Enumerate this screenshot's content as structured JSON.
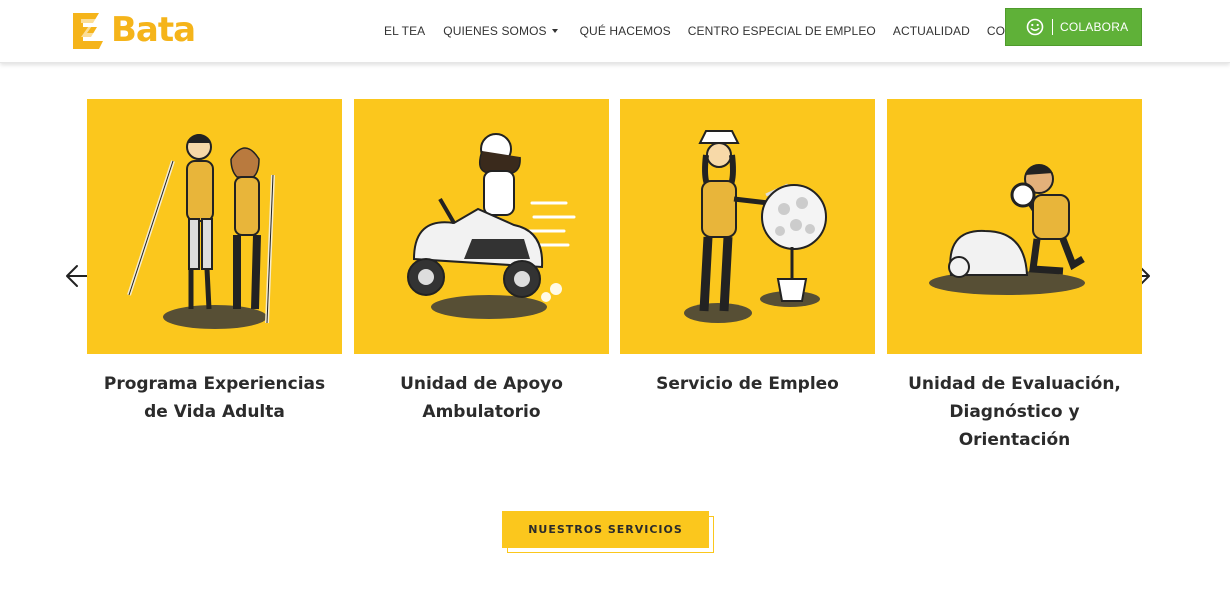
{
  "brand": {
    "name": "Bata",
    "logo_icon": "bata-logo-icon",
    "color": "#f5b41a"
  },
  "nav": {
    "items": [
      {
        "label": "EL TEA"
      },
      {
        "label": "QUIENES SOMOS",
        "has_dropdown": true
      },
      {
        "label": "QUÉ HACEMOS"
      },
      {
        "label": "CENTRO ESPECIAL DE EMPLEO"
      },
      {
        "label": "ACTUALIDAD"
      },
      {
        "label": "CONTACTO"
      }
    ],
    "cta": {
      "label": "COLABORA",
      "icon": "smiley-icon",
      "color": "#5fb138"
    }
  },
  "carousel": {
    "prev_icon": "arrow-left-icon",
    "next_icon": "arrow-right-icon",
    "tile_color": "#fbc71d",
    "cards": [
      {
        "title": "Programa Experiencias de Vida Adulta",
        "image": "two-people-with-walking-sticks"
      },
      {
        "title": "Unidad de Apoyo Ambulatorio",
        "image": "woman-riding-scooter"
      },
      {
        "title": "Servicio de Empleo",
        "image": "gardener-pruning-tree"
      },
      {
        "title": "Unidad de Evaluación, Diagnóstico y Orientación",
        "image": "man-with-magnifying-glass"
      }
    ]
  },
  "services_button": {
    "label": "NUESTROS SERVICIOS"
  }
}
